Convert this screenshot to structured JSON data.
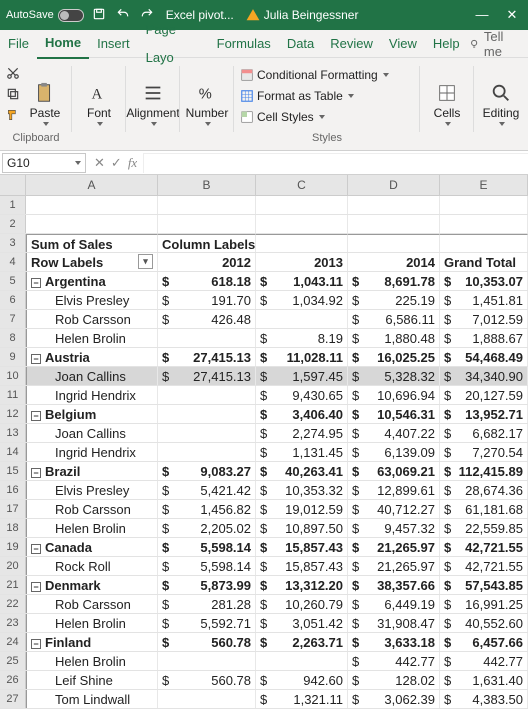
{
  "title": {
    "autosave": "AutoSave",
    "filename": "Excel pivot...",
    "username": "Julia Beingessner"
  },
  "tabs": {
    "file": "File",
    "home": "Home",
    "insert": "Insert",
    "page": "Page Layo",
    "formulas": "Formulas",
    "data": "Data",
    "review": "Review",
    "view": "View",
    "help": "Help",
    "tellme": "Tell me"
  },
  "ribbon": {
    "clipboard": "Clipboard",
    "paste": "Paste",
    "font": "Font",
    "alignment": "Alignment",
    "number": "Number",
    "styles": "Styles",
    "cond": "Conditional Formatting",
    "table": "Format as Table",
    "cellstyles": "Cell Styles",
    "cells": "Cells",
    "editing": "Editing"
  },
  "namebox": "G10",
  "colheads": {
    "a": "A",
    "b": "B",
    "c": "C",
    "d": "D",
    "e": "E"
  },
  "pivot": {
    "sumsales": "Sum of Sales",
    "collabels": "Column Labels",
    "rowlabels": "Row Labels",
    "y2012": "2012",
    "y2013": "2013",
    "y2014": "2014",
    "grand": "Grand Total"
  },
  "data": {
    "argentina": {
      "label": "Argentina",
      "v": [
        "618.18",
        "1,043.11",
        "8,691.78",
        "10,353.07"
      ]
    },
    "elvis1": {
      "label": "Elvis Presley",
      "v": [
        "191.70",
        "1,034.92",
        "225.19",
        "1,451.81"
      ]
    },
    "rob1": {
      "label": "Rob Carsson",
      "v": [
        "426.48",
        "",
        "6,586.11",
        "7,012.59"
      ]
    },
    "helen1": {
      "label": "Helen Brolin",
      "v": [
        "",
        "8.19",
        "1,880.48",
        "1,888.67"
      ]
    },
    "austria": {
      "label": "Austria",
      "v": [
        "27,415.13",
        "11,028.11",
        "16,025.25",
        "54,468.49"
      ]
    },
    "joan1": {
      "label": "Joan Callins",
      "v": [
        "27,415.13",
        "1,597.45",
        "5,328.32",
        "34,340.90"
      ]
    },
    "ingrid1": {
      "label": "Ingrid Hendrix",
      "v": [
        "",
        "9,430.65",
        "10,696.94",
        "20,127.59"
      ]
    },
    "belgium": {
      "label": "Belgium",
      "v": [
        "",
        "3,406.40",
        "10,546.31",
        "13,952.71"
      ]
    },
    "joan2": {
      "label": "Joan Callins",
      "v": [
        "",
        "2,274.95",
        "4,407.22",
        "6,682.17"
      ]
    },
    "ingrid2": {
      "label": "Ingrid Hendrix",
      "v": [
        "",
        "1,131.45",
        "6,139.09",
        "7,270.54"
      ]
    },
    "brazil": {
      "label": "Brazil",
      "v": [
        "9,083.27",
        "40,263.41",
        "63,069.21",
        "112,415.89"
      ]
    },
    "elvis2": {
      "label": "Elvis Presley",
      "v": [
        "5,421.42",
        "10,353.32",
        "12,899.61",
        "28,674.36"
      ]
    },
    "rob2": {
      "label": "Rob Carsson",
      "v": [
        "1,456.82",
        "19,012.59",
        "40,712.27",
        "61,181.68"
      ]
    },
    "helen2": {
      "label": "Helen Brolin",
      "v": [
        "2,205.02",
        "10,897.50",
        "9,457.32",
        "22,559.85"
      ]
    },
    "canada": {
      "label": "Canada",
      "v": [
        "5,598.14",
        "15,857.43",
        "21,265.97",
        "42,721.55"
      ]
    },
    "rock": {
      "label": "Rock Roll",
      "v": [
        "5,598.14",
        "15,857.43",
        "21,265.97",
        "42,721.55"
      ]
    },
    "denmark": {
      "label": "Denmark",
      "v": [
        "5,873.99",
        "13,312.20",
        "38,357.66",
        "57,543.85"
      ]
    },
    "rob3": {
      "label": "Rob Carsson",
      "v": [
        "281.28",
        "10,260.79",
        "6,449.19",
        "16,991.25"
      ]
    },
    "helen3": {
      "label": "Helen Brolin",
      "v": [
        "5,592.71",
        "3,051.42",
        "31,908.47",
        "40,552.60"
      ]
    },
    "finland": {
      "label": "Finland",
      "v": [
        "560.78",
        "2,263.71",
        "3,633.18",
        "6,457.66"
      ]
    },
    "helen4": {
      "label": "Helen Brolin",
      "v": [
        "",
        "",
        "442.77",
        "442.77"
      ]
    },
    "leif": {
      "label": "Leif Shine",
      "v": [
        "560.78",
        "942.60",
        "128.02",
        "1,631.40"
      ]
    },
    "tom": {
      "label": "Tom Lindwall",
      "v": [
        "",
        "1,321.11",
        "3,062.39",
        "4,383.50"
      ]
    }
  },
  "rownums": [
    "1",
    "2",
    "3",
    "4",
    "5",
    "6",
    "7",
    "8",
    "9",
    "10",
    "11",
    "12",
    "13",
    "14",
    "15",
    "16",
    "17",
    "18",
    "19",
    "20",
    "21",
    "22",
    "23",
    "24",
    "25",
    "26",
    "27"
  ]
}
